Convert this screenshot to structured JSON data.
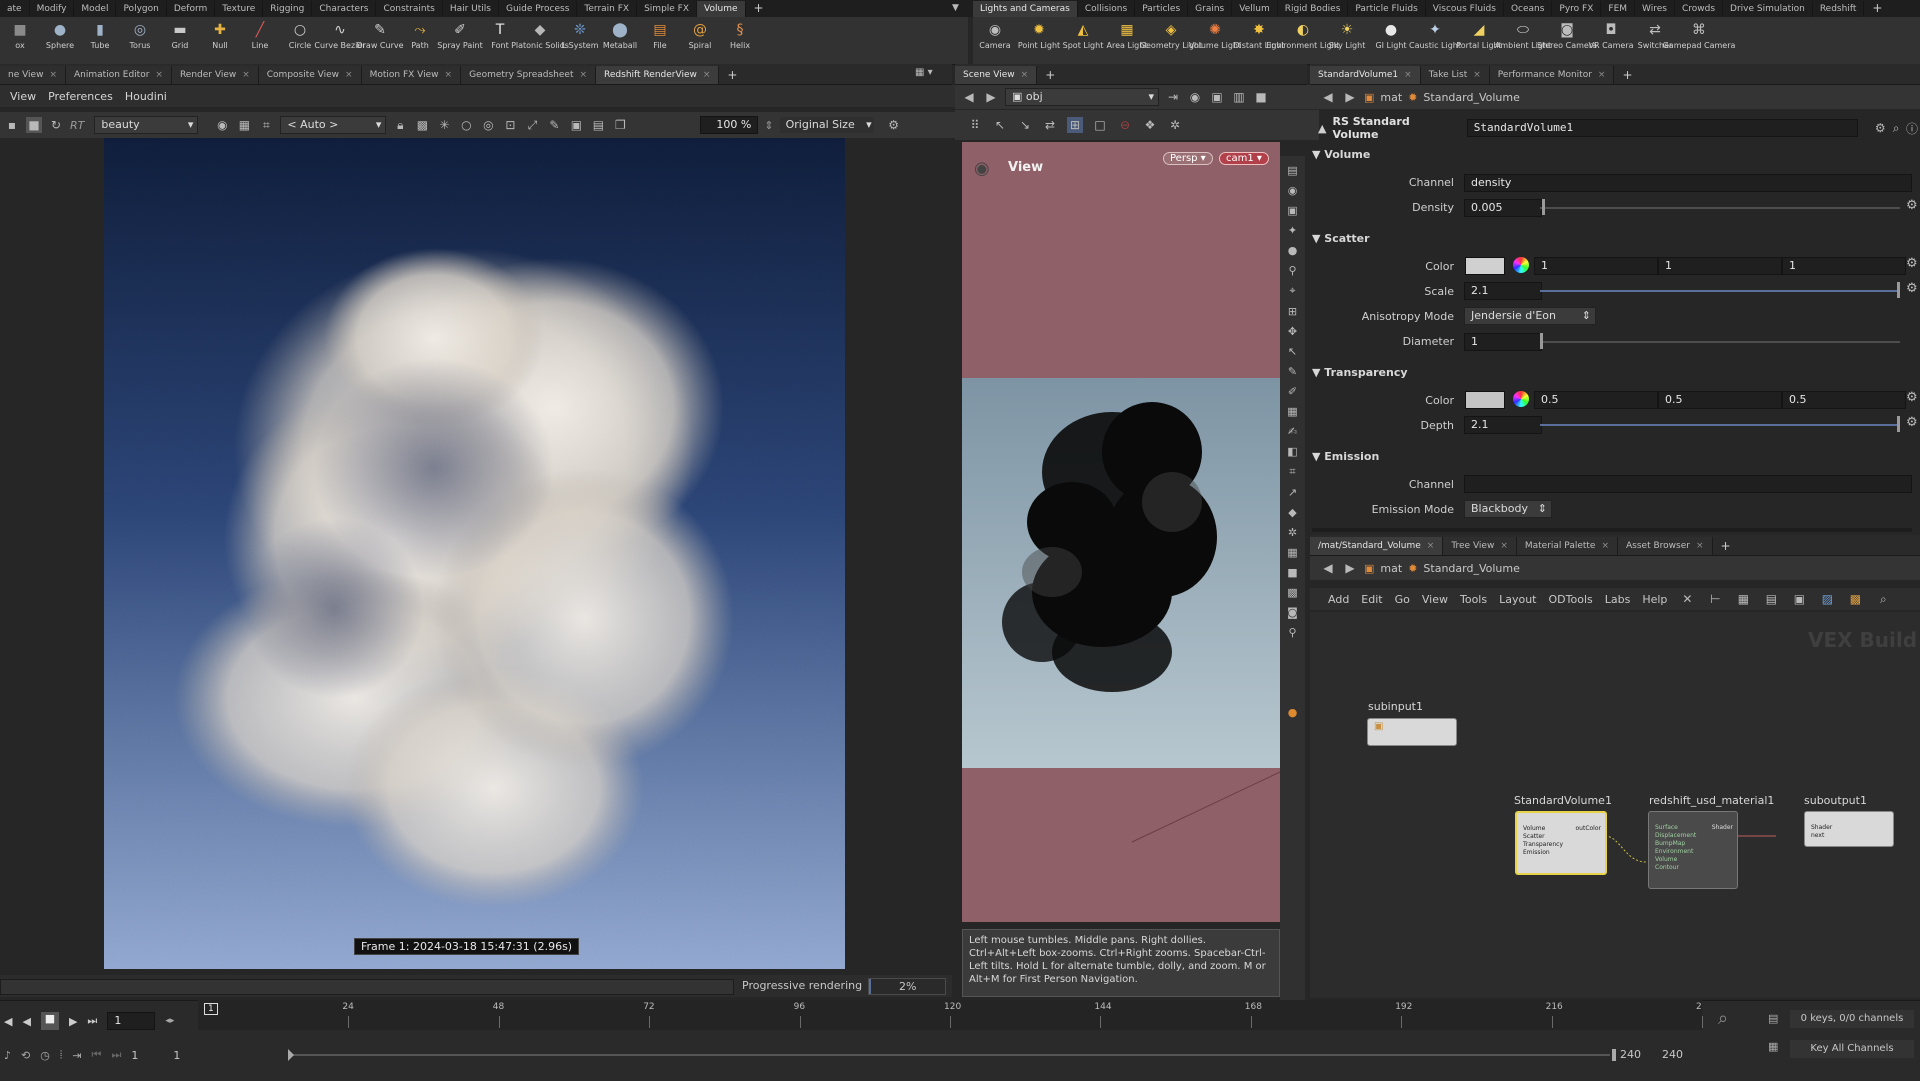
{
  "left_shelf": {
    "tabs": [
      {
        "label": "ate"
      },
      {
        "label": "Modify"
      },
      {
        "label": "Model"
      },
      {
        "label": "Polygon"
      },
      {
        "label": "Deform"
      },
      {
        "label": "Texture"
      },
      {
        "label": "Rigging"
      },
      {
        "label": "Characters"
      },
      {
        "label": "Constraints"
      },
      {
        "label": "Hair Utils"
      },
      {
        "label": "Guide Process"
      },
      {
        "label": "Terrain FX"
      },
      {
        "label": "Simple FX"
      },
      {
        "label": "Volume"
      }
    ],
    "tools": [
      {
        "label": "ox",
        "icon": "box-icon",
        "glyph": "■",
        "color": "#8a8a8a"
      },
      {
        "label": "Sphere",
        "icon": "sphere-icon",
        "glyph": "●",
        "color": "#9fb3c8"
      },
      {
        "label": "Tube",
        "icon": "tube-icon",
        "glyph": "▮",
        "color": "#9fb3c8"
      },
      {
        "label": "Torus",
        "icon": "torus-icon",
        "glyph": "◎",
        "color": "#9fb3c8"
      },
      {
        "label": "Grid",
        "icon": "grid-icon",
        "glyph": "▬",
        "color": "#c9c9c9"
      },
      {
        "label": "Null",
        "icon": "null-icon",
        "glyph": "✚",
        "color": "#e4b341"
      },
      {
        "label": "Line",
        "icon": "line-icon",
        "glyph": "╱",
        "color": "#d95a5a"
      },
      {
        "label": "Circle",
        "icon": "circle-icon",
        "glyph": "○",
        "color": "#cfcfcf"
      },
      {
        "label": "Curve Bezier",
        "icon": "curve-bezier-icon",
        "glyph": "∿",
        "color": "#cfcfcf"
      },
      {
        "label": "Draw Curve",
        "icon": "draw-curve-icon",
        "glyph": "✎",
        "color": "#cfcfcf"
      },
      {
        "label": "Path",
        "icon": "path-icon",
        "glyph": "⤳",
        "color": "#e4b341"
      },
      {
        "label": "Spray Paint",
        "icon": "spray-paint-icon",
        "glyph": "✐",
        "color": "#cfcfcf"
      },
      {
        "label": "Font",
        "icon": "font-icon",
        "glyph": "T",
        "color": "#e8e8e8"
      },
      {
        "label": "Platonic Solids",
        "icon": "platonic-solids-icon",
        "glyph": "◆",
        "color": "#b8b8b8"
      },
      {
        "label": "L-System",
        "icon": "l-system-icon",
        "glyph": "❊",
        "color": "#6fa0d8"
      },
      {
        "label": "Metaball",
        "icon": "metaball-icon",
        "glyph": "⬤",
        "color": "#9fb3c8"
      },
      {
        "label": "File",
        "icon": "file-icon",
        "glyph": "▤",
        "color": "#e08a3a"
      },
      {
        "label": "Spiral",
        "icon": "spiral-icon",
        "glyph": "@",
        "color": "#e4a040"
      },
      {
        "label": "Helix",
        "icon": "helix-icon",
        "glyph": "§",
        "color": "#e09050"
      }
    ]
  },
  "right_shelf": {
    "tabs": [
      {
        "label": "Lights and Cameras"
      },
      {
        "label": "Collisions"
      },
      {
        "label": "Particles"
      },
      {
        "label": "Grains"
      },
      {
        "label": "Vellum"
      },
      {
        "label": "Rigid Bodies"
      },
      {
        "label": "Particle Fluids"
      },
      {
        "label": "Viscous Fluids"
      },
      {
        "label": "Oceans"
      },
      {
        "label": "Pyro FX"
      },
      {
        "label": "FEM"
      },
      {
        "label": "Wires"
      },
      {
        "label": "Crowds"
      },
      {
        "label": "Drive Simulation"
      },
      {
        "label": "Redshift"
      }
    ],
    "tools": [
      {
        "label": "Camera",
        "icon": "camera-icon",
        "glyph": "◉",
        "color": "#bcbcbc"
      },
      {
        "label": "Point Light",
        "icon": "point-light-icon",
        "glyph": "✹",
        "color": "#f0c040"
      },
      {
        "label": "Spot Light",
        "icon": "spot-light-icon",
        "glyph": "◭",
        "color": "#f0c040"
      },
      {
        "label": "Area Light",
        "icon": "area-light-icon",
        "glyph": "▦",
        "color": "#f0c040"
      },
      {
        "label": "Geometry Light",
        "icon": "geometry-light-icon",
        "glyph": "◈",
        "color": "#f0c040"
      },
      {
        "label": "Volume Light",
        "icon": "volume-light-icon",
        "glyph": "✺",
        "color": "#f08040"
      },
      {
        "label": "Distant Light",
        "icon": "distant-light-icon",
        "glyph": "✸",
        "color": "#f0c040"
      },
      {
        "label": "Environment Light",
        "icon": "environment-light-icon",
        "glyph": "◐",
        "color": "#f0d060"
      },
      {
        "label": "Sky Light",
        "icon": "sky-light-icon",
        "glyph": "☀",
        "color": "#f0d060"
      },
      {
        "label": "GI Light",
        "icon": "gi-light-icon",
        "glyph": "●",
        "color": "#e8e8e8"
      },
      {
        "label": "Caustic Light",
        "icon": "caustic-light-icon",
        "glyph": "✦",
        "color": "#bcd0e8"
      },
      {
        "label": "Portal Light",
        "icon": "portal-light-icon",
        "glyph": "◢",
        "color": "#f0d060"
      },
      {
        "label": "Ambient Light",
        "icon": "ambient-light-icon",
        "glyph": "⬭",
        "color": "#d8d8d8"
      },
      {
        "label": "Stereo Camera",
        "icon": "stereo-camera-icon",
        "glyph": "◙",
        "color": "#bcbcbc"
      },
      {
        "label": "VR Camera",
        "icon": "vr-camera-icon",
        "glyph": "◘",
        "color": "#bcbcbc"
      },
      {
        "label": "Switcher",
        "icon": "switcher-icon",
        "glyph": "⇄",
        "color": "#bcbcbc"
      },
      {
        "label": "Gamepad Camera",
        "icon": "gamepad-camera-icon",
        "glyph": "⌘",
        "color": "#bcbcbc"
      }
    ]
  },
  "render_pane": {
    "tabs": [
      {
        "label": "ne View"
      },
      {
        "label": "Animation Editor"
      },
      {
        "label": "Render View"
      },
      {
        "label": "Composite View"
      },
      {
        "label": "Motion FX View"
      },
      {
        "label": "Geometry Spreadsheet"
      },
      {
        "label": "Redshift RenderView",
        "active": true
      }
    ],
    "menu": [
      "View",
      "Preferences",
      "Houdini"
    ],
    "rt_label": "RT",
    "aov": "beauty",
    "camera_select": "< Auto >",
    "zoom": "100 %",
    "size_mode": "Original Size",
    "frame_info": "Frame 1: 2024-03-18 15:47:31 (2.96s)",
    "progressive_label": "Progressive rendering",
    "progress_text": "2%",
    "progress_fraction": 0.02
  },
  "scene_view": {
    "tab": "Scene View",
    "path": "obj",
    "view_label": "View",
    "persp_button": "Persp",
    "cam_button": "cam1",
    "help_text": "Left mouse tumbles. Middle pans. Right dollies. Ctrl+Alt+Left box-zooms. Ctrl+Right zooms. Spacebar-Ctrl-Left tilts. Hold L for alternate tumble, dolly, and zoom. M or Alt+M for First Person Navigation."
  },
  "params_pane": {
    "tabs": [
      {
        "label": "StandardVolume1",
        "active": true
      },
      {
        "label": "Take List"
      },
      {
        "label": "Performance Monitor"
      }
    ],
    "path": [
      "mat",
      "Standard_Volume"
    ],
    "node_type": "RS Standard Volume",
    "node_name": "StandardVolume1",
    "sections": {
      "volume": {
        "title": "Volume",
        "channel_label": "Channel",
        "channel_value": "density",
        "density_label": "Density",
        "density_value": "0.005",
        "density_fraction": 0.005
      },
      "scatter": {
        "title": "Scatter",
        "color_label": "Color",
        "color_r": "1",
        "color_g": "1",
        "color_b": "1",
        "scale_label": "Scale",
        "scale_value": "2.1",
        "scale_fraction": 1.0,
        "anisotropy_label": "Anisotropy Mode",
        "anisotropy_value": "Jendersie d'Eon",
        "diameter_label": "Diameter",
        "diameter_value": "1",
        "diameter_fraction": 0.0
      },
      "transparency": {
        "title": "Transparency",
        "color_label": "Color",
        "color_r": "0.5",
        "color_g": "0.5",
        "color_b": "0.5",
        "depth_label": "Depth",
        "depth_value": "2.1",
        "depth_fraction": 1.0
      },
      "emission": {
        "title": "Emission",
        "channel_label": "Channel",
        "channel_value": "",
        "mode_label": "Emission Mode",
        "mode_value": "Blackbody"
      }
    }
  },
  "network_pane": {
    "tabs": [
      {
        "label": "/mat/Standard_Volume",
        "active": true
      },
      {
        "label": "Tree View"
      },
      {
        "label": "Material Palette"
      },
      {
        "label": "Asset Browser"
      }
    ],
    "path": [
      "mat",
      "Standard_Volume"
    ],
    "menu": [
      "Add",
      "Edit",
      "Go",
      "View",
      "Tools",
      "Layout",
      "ODTools",
      "Labs",
      "Help"
    ],
    "watermark": "VEX Build",
    "nodes": {
      "subinput": {
        "name": "subinput1"
      },
      "standard_volume": {
        "name": "StandardVolume1",
        "ports": [
          "Volume",
          "Scatter",
          "Transparency",
          "Emission"
        ],
        "out": "outColor"
      },
      "usd_material": {
        "name": "redshift_usd_material1",
        "ports": [
          "Surface",
          "Displacement",
          "BumpMap",
          "Environment",
          "Volume",
          "Contour"
        ],
        "out": "Shader"
      },
      "suboutput": {
        "name": "suboutput1",
        "ports": [
          "Shader",
          "next"
        ]
      }
    }
  },
  "timeline": {
    "ticks": [
      "24",
      "48",
      "72",
      "96",
      "120",
      "144",
      "168",
      "192",
      "216",
      "2"
    ],
    "current_frame": "1",
    "marker": "1",
    "start": "1",
    "start2": "1",
    "end": "240",
    "end2": "240",
    "keys_info": "0 keys, 0/0 channels",
    "key_all": "Key All Channels"
  },
  "colors": {
    "accent_node": "#e8d24a",
    "viewport_bg": "#8f6068",
    "link": "#6a8fd0"
  }
}
